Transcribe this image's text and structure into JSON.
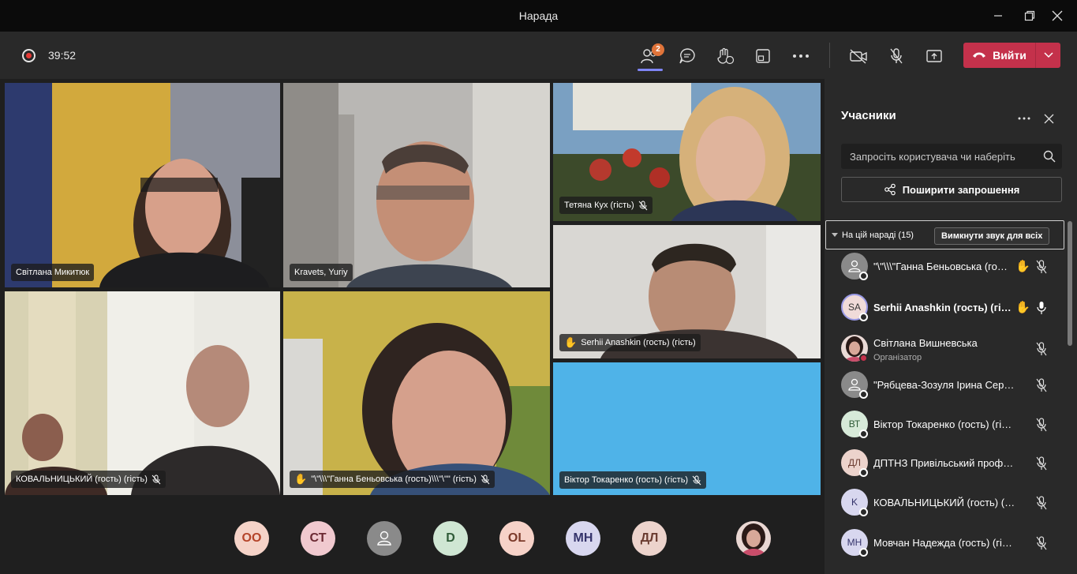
{
  "window": {
    "title": "Нарада"
  },
  "toolbar": {
    "timer": "39:52",
    "participants_badge": "2",
    "leave_label": "Вийти",
    "colors": {
      "leave": "#c4314b",
      "accent": "#7f85f5",
      "badge": "#e0743a"
    }
  },
  "tiles": [
    {
      "name": "Світлана Микитюк"
    },
    {
      "name": "Kravets, Yuriy"
    },
    {
      "name": "Тетяна Кух (гість)"
    },
    {
      "name": "Serhii Anashkin (гость) (гість)"
    },
    {
      "name": "КОВАЛЬНИЦЬКИЙ (гость) (гість)"
    },
    {
      "name": "\"\\\"\\\\\\\"Ганна Беньовська (гость)\\\\\\\"\\\"\" (гість)"
    },
    {
      "name": "Віктор Токаренко (гость) (гість)"
    }
  ],
  "avatars": [
    {
      "initials": "OO"
    },
    {
      "initials": "СТ"
    },
    {
      "initials": ""
    },
    {
      "initials": "D"
    },
    {
      "initials": "OL"
    },
    {
      "initials": "МН"
    },
    {
      "initials": "ДЛ"
    }
  ],
  "panel": {
    "title": "Учасники",
    "search_placeholder": "Запросіть користувача чи наберіть",
    "share_label": "Поширити запрошення",
    "section_label": "На цій нараді (15)",
    "mute_all_label": "Вимкнути звук для всіх",
    "participants": [
      {
        "name": "\"\\\"\\\\\\\"Ганна Беньовська (гость)\\\\\\\"\\\"\" (гість)",
        "initials": "",
        "hand": true,
        "mic": "muted"
      },
      {
        "name": "Serhii Anashkin (гость) (гість)",
        "initials": "SA",
        "hand": true,
        "mic": "on"
      },
      {
        "name": "Світлана Вишневська",
        "role": "Організатор",
        "initials": "",
        "hand": false,
        "mic": "muted"
      },
      {
        "name": "\"Рябцева-Зозуля Ірина Сергіївна\"",
        "initials": "",
        "hand": false,
        "mic": "muted"
      },
      {
        "name": "Віктор Токаренко (гость) (гість)",
        "initials": "ВТ",
        "hand": false,
        "mic": "muted"
      },
      {
        "name": "ДПТНЗ Привільський професійний ліцей",
        "initials": "ДЛ",
        "hand": false,
        "mic": "muted"
      },
      {
        "name": "КОВАЛЬНИЦЬКИЙ (гость) (гість)",
        "initials": "K",
        "hand": false,
        "mic": "muted"
      },
      {
        "name": "Мовчан Надежда (гость) (гість)",
        "initials": "МН",
        "hand": false,
        "mic": "muted"
      }
    ]
  }
}
